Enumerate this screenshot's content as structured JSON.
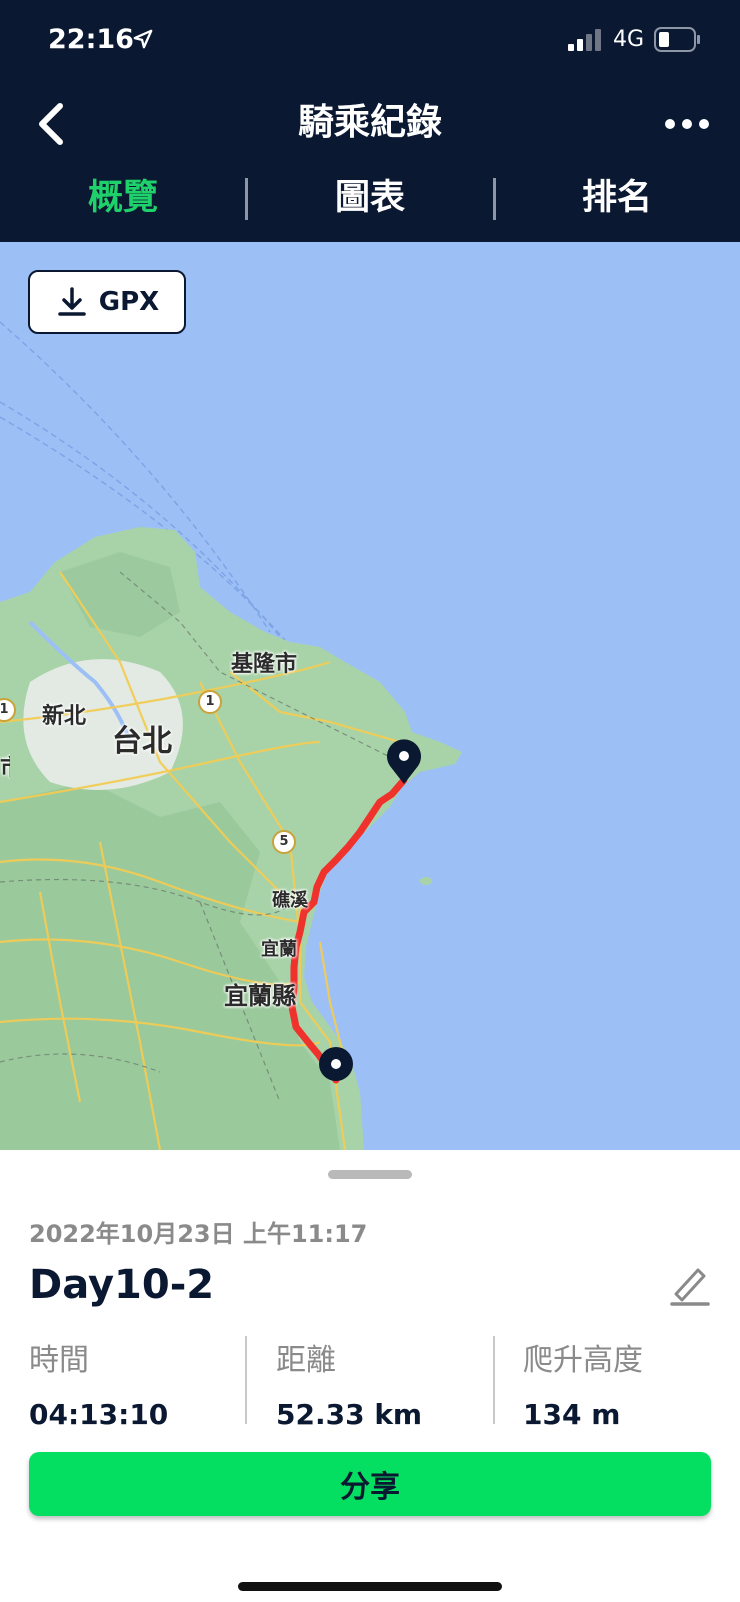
{
  "status_bar": {
    "time": "22:16",
    "network": "4G",
    "icons": [
      "location-arrow-icon",
      "signal-icon",
      "battery-icon"
    ]
  },
  "nav": {
    "title": "騎乘紀錄",
    "back_icon": "chevron-left-icon",
    "more_icon": "more-horizontal-icon",
    "tabs": [
      {
        "label": "概覽",
        "active": true
      },
      {
        "label": "圖表",
        "active": false
      },
      {
        "label": "排名",
        "active": false
      }
    ]
  },
  "map": {
    "gpx_button": {
      "label": "GPX",
      "icon": "download-icon"
    },
    "labels": {
      "keelung": "基隆市",
      "new_taipei": "新北",
      "taipei": "台北",
      "jiaoxi": "礁溪",
      "yilan": "宜蘭",
      "yilan_county": "宜蘭縣",
      "edge": "市"
    },
    "road_shields": [
      "1",
      "1",
      "5"
    ],
    "route_color": "#f0322d",
    "marker_color": "#0b1831"
  },
  "ride": {
    "date": "2022年10月23日 上午11:17",
    "title": "Day10-2",
    "edit_icon": "edit-icon",
    "stats": [
      {
        "label": "時間",
        "value": "04:13:10"
      },
      {
        "label": "距離",
        "value": "52.33 km"
      },
      {
        "label": "爬升高度",
        "value": "134 m"
      }
    ],
    "share_label": "分享"
  },
  "colors": {
    "header_bg": "#0b1831",
    "active_tab": "#1fd16a",
    "share_button": "#05df61",
    "sea": "#9cc0f6",
    "land": "#a8d3a8"
  }
}
